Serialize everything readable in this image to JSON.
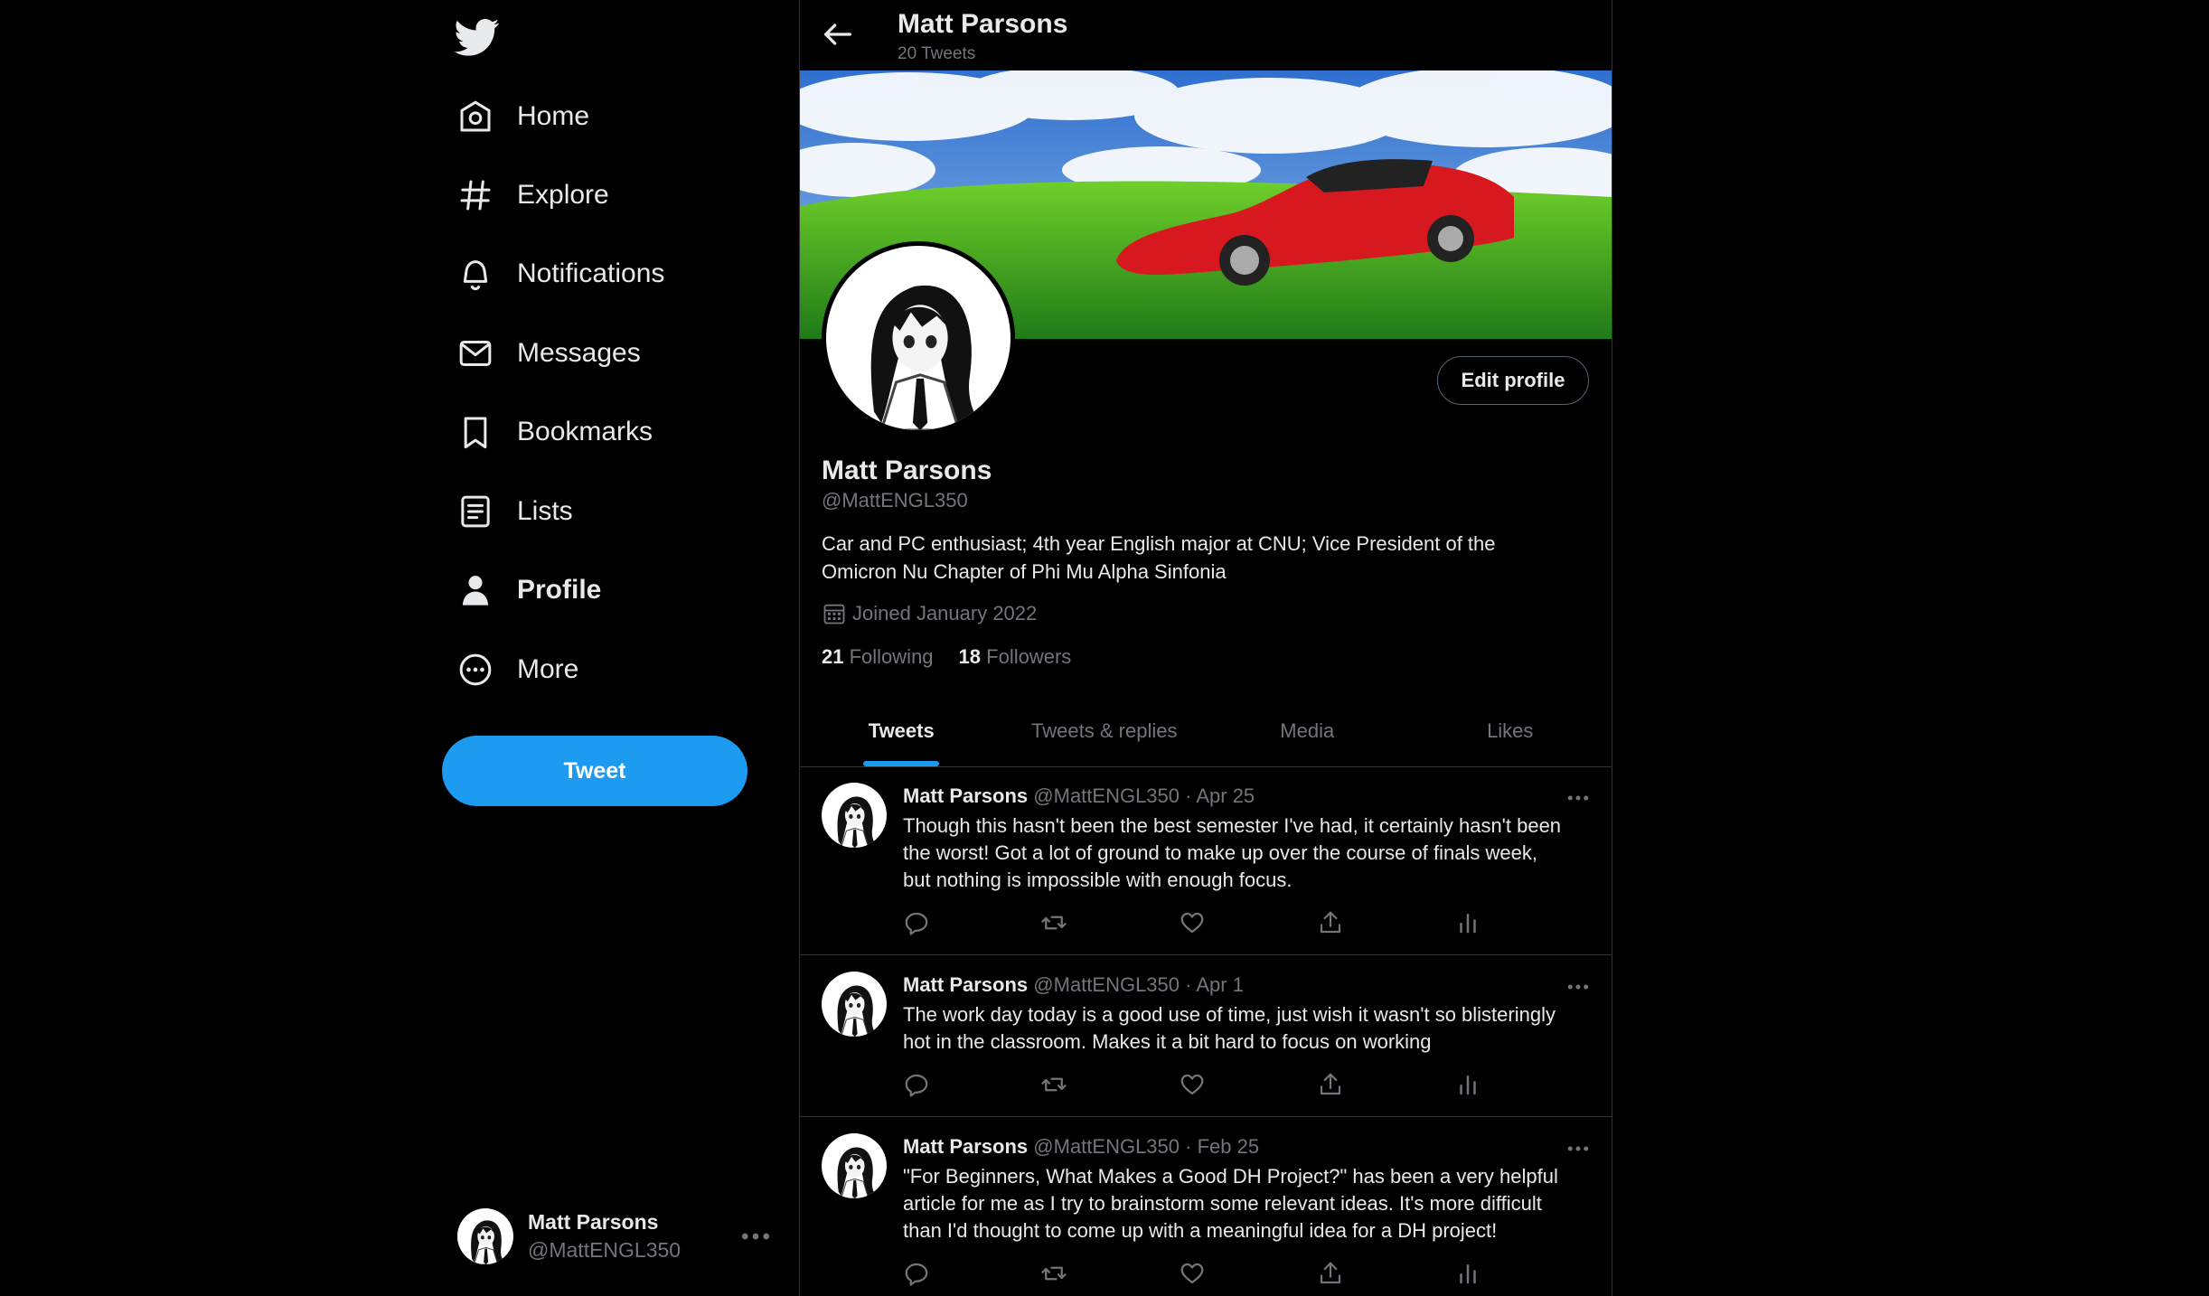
{
  "sidebar": {
    "nav": [
      {
        "label": "Home",
        "icon": "home-icon"
      },
      {
        "label": "Explore",
        "icon": "hashtag-icon"
      },
      {
        "label": "Notifications",
        "icon": "bell-icon"
      },
      {
        "label": "Messages",
        "icon": "envelope-icon"
      },
      {
        "label": "Bookmarks",
        "icon": "bookmark-icon"
      },
      {
        "label": "Lists",
        "icon": "list-icon"
      },
      {
        "label": "Profile",
        "icon": "person-icon"
      },
      {
        "label": "More",
        "icon": "more-circle-icon"
      }
    ],
    "active": "Profile",
    "tweet_button": "Tweet",
    "account": {
      "name": "Matt Parsons",
      "handle": "@MattENGL350"
    }
  },
  "header": {
    "name": "Matt Parsons",
    "tweet_count": "20 Tweets"
  },
  "profile": {
    "name": "Matt Parsons",
    "handle": "@MattENGL350",
    "bio_line1": "Car and PC enthusiast; 4th year English major at CNU; Vice President of the",
    "bio_line2": "Omicron Nu Chapter of Phi Mu Alpha Sinfonia",
    "joined": "Joined January 2022",
    "following_count": "21",
    "following_label": "Following",
    "followers_count": "18",
    "followers_label": "Followers",
    "edit_button": "Edit profile"
  },
  "tabs": [
    {
      "label": "Tweets"
    },
    {
      "label": "Tweets & replies"
    },
    {
      "label": "Media"
    },
    {
      "label": "Likes"
    }
  ],
  "tweets": [
    {
      "name": "Matt Parsons",
      "meta": "@MattENGL350 · Apr 25",
      "lines": [
        "Though this hasn't been the best semester I've had, it certainly hasn't been",
        "the worst!  Got a lot of ground to make up over the course of finals week,",
        "but nothing is impossible with enough focus."
      ]
    },
    {
      "name": "Matt Parsons",
      "meta": "@MattENGL350 · Apr 1",
      "lines": [
        "The work day today is a good use of time, just wish it wasn't so blisteringly",
        "hot in the classroom.  Makes it a bit hard to focus on working"
      ]
    },
    {
      "name": "Matt Parsons",
      "meta": "@MattENGL350 · Feb 25",
      "lines": [
        "\"For Beginners, What Makes a Good DH Project?\" has been a very helpful",
        "article for me as I try to brainstorm some relevant ideas.  It's more difficult",
        "than I'd thought to come up with a meaningful idea for a DH project!"
      ]
    }
  ],
  "colors": {
    "accent": "#1d9bf0",
    "background": "#000000",
    "text": "#e7e9ea",
    "muted": "#71767b",
    "border": "#2f3336"
  }
}
